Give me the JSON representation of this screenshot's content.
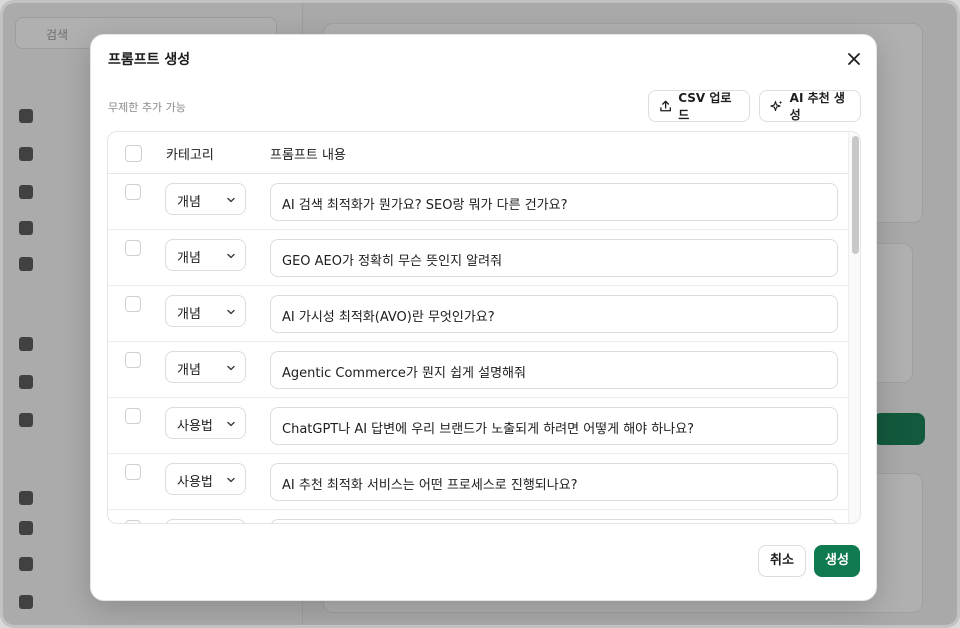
{
  "background": {
    "search_placeholder": "검색"
  },
  "modal": {
    "title": "프롬프트 생성",
    "subtitle": "무제한 추가 가능",
    "csv_button": "CSV 업로드",
    "ai_button": "AI 추천 생성",
    "cancel_button": "취소",
    "generate_button": "생성",
    "accent_color": "#0f7a4f"
  },
  "table": {
    "columns": [
      "카테고리",
      "프롬프트 내용"
    ],
    "rows": [
      {
        "category": "개념",
        "prompt": "AI 검색 최적화가 뭔가요? SEO랑 뭐가 다른 건가요?"
      },
      {
        "category": "개념",
        "prompt": "GEO AEO가 정확히 무슨 뜻인지 알려줘"
      },
      {
        "category": "개념",
        "prompt": "AI 가시성 최적화(AVO)란 무엇인가요?"
      },
      {
        "category": "개념",
        "prompt": "Agentic Commerce가 뭔지 쉽게 설명해줘"
      },
      {
        "category": "사용법",
        "prompt": "ChatGPT나 AI 답변에 우리 브랜드가 노출되게 하려면 어떻게 해야 하나요?"
      },
      {
        "category": "사용법",
        "prompt": "AI 추천 최적화 서비스는 어떤 프로세스로 진행되나요?"
      }
    ]
  }
}
